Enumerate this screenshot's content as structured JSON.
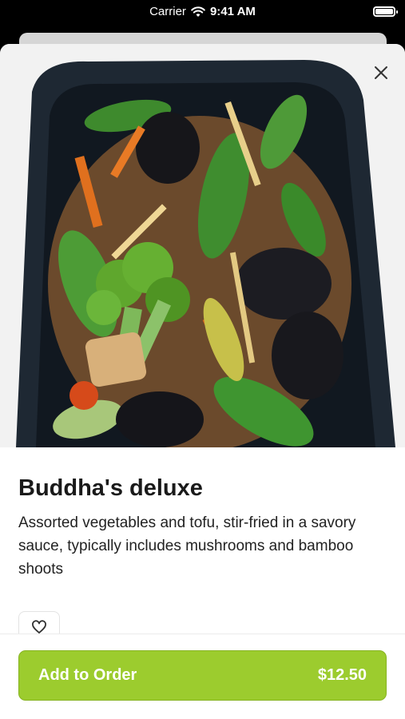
{
  "status_bar": {
    "carrier": "Carrier",
    "time": "9:41 AM"
  },
  "item": {
    "name": "Buddha's deluxe",
    "description": "Assorted vegetables and tofu, stir-fried in a savory sauce, typically includes mushrooms and bamboo shoots",
    "image_icon": "food-photo-icon"
  },
  "actions": {
    "close_icon": "close-icon",
    "favorite_icon": "heart-icon",
    "add_label": "Add to Order",
    "price": "$12.50"
  },
  "colors": {
    "accent": "#9ccc2e",
    "background": "#ffffff",
    "status_bar": "#000000"
  }
}
